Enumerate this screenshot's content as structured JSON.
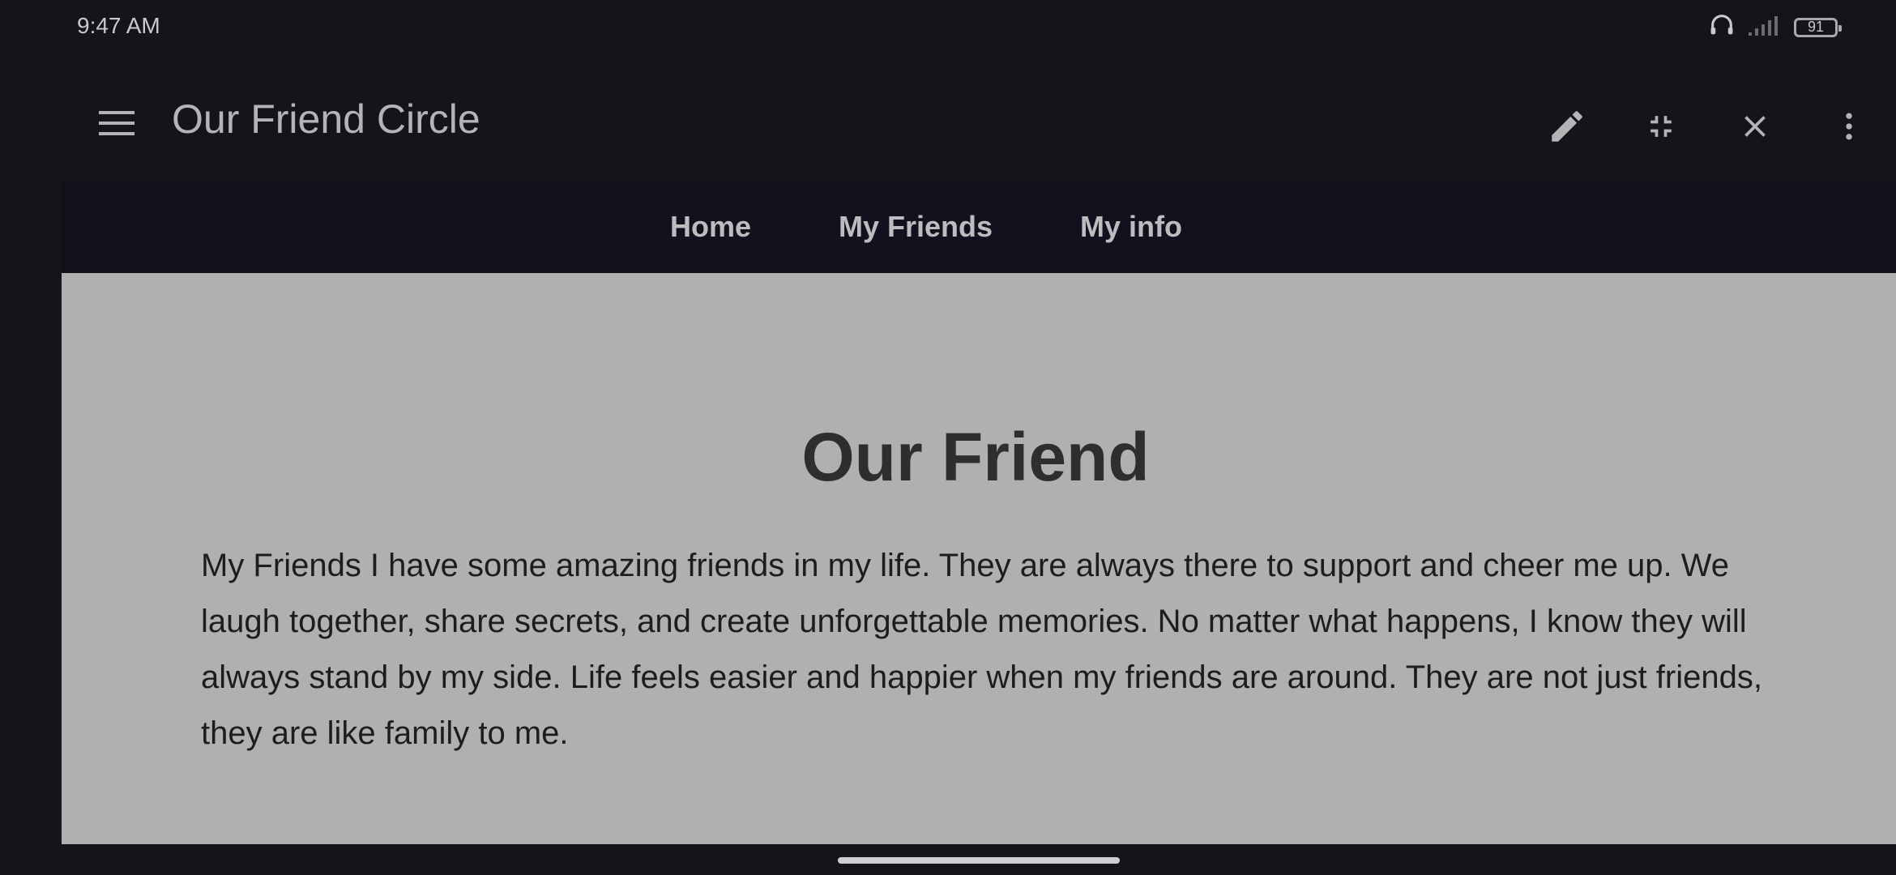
{
  "status_bar": {
    "time": "9:47 AM",
    "battery_level": "91",
    "icons": [
      "headphones-icon",
      "signal-icon",
      "battery-icon"
    ]
  },
  "app_bar": {
    "title": "Our Friend Circle",
    "icons": [
      "menu-icon",
      "edit-icon",
      "collapse-icon",
      "close-icon",
      "more-vert-icon"
    ]
  },
  "nav": {
    "items": [
      {
        "label": "Home"
      },
      {
        "label": "My Friends"
      },
      {
        "label": "My info"
      }
    ]
  },
  "main": {
    "heading": "Our Friend",
    "paragraph": "My Friends I have some amazing friends in my life. They are always there to support and cheer me up. We laugh together, share secrets, and create unforgettable memories. No matter what happens, I know they will always stand by my side. Life feels easier and happier when my friends are around. They are not just friends, they are like family to me."
  },
  "colors": {
    "background": "#141518",
    "nav_background": "#12121f",
    "content_background": "#b0b0b0",
    "text_dark": "#2e2e2e",
    "text_light": "#b3b4b6"
  }
}
